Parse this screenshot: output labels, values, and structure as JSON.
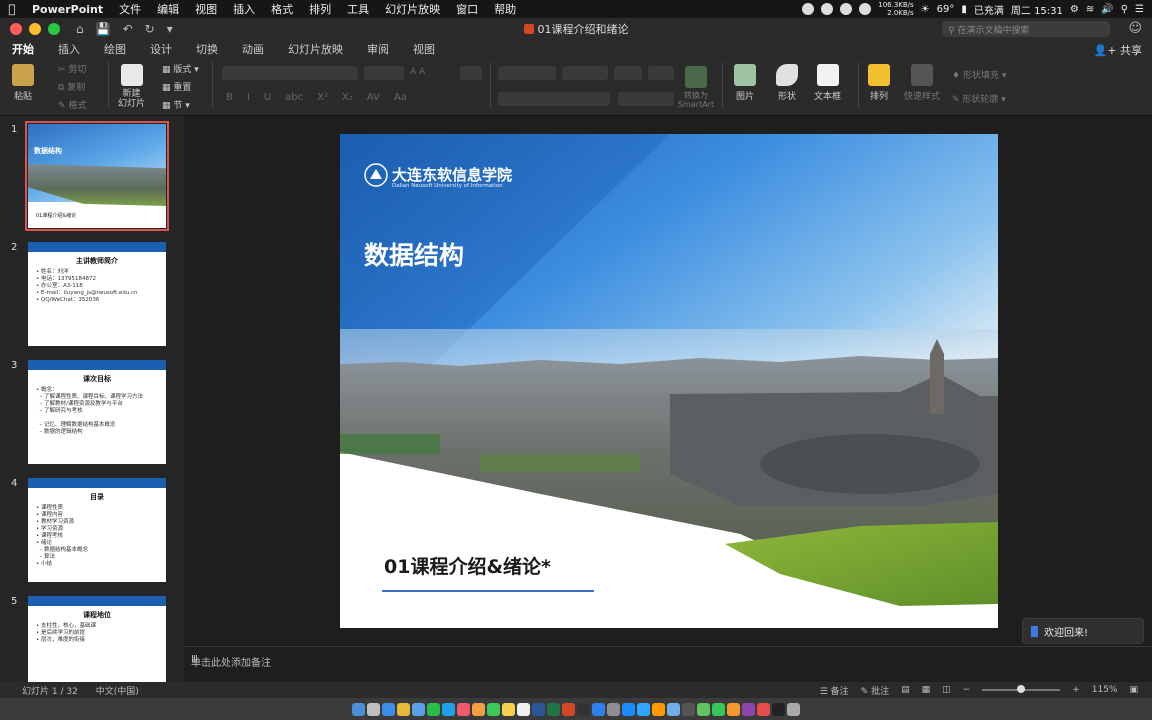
{
  "menubar": {
    "app_name": "PowerPoint",
    "menus": [
      "文件",
      "编辑",
      "视图",
      "插入",
      "格式",
      "排列",
      "工具",
      "幻灯片放映",
      "窗口",
      "帮助"
    ],
    "net_up": "106.3KB/s",
    "net_down": "2.0KB/s",
    "temperature": "69°",
    "battery": "已充满",
    "clock": "周二 15:31"
  },
  "window": {
    "title": "01课程介绍和绪论",
    "search_placeholder": "在演示文稿中搜索"
  },
  "ribbon_tabs": [
    "开始",
    "插入",
    "绘图",
    "设计",
    "切换",
    "动画",
    "幻灯片放映",
    "审阅",
    "视图"
  ],
  "active_tab": "开始",
  "share_label": "共享",
  "ribbon": {
    "paste": "粘贴",
    "cut": "剪切",
    "copy": "复制",
    "format": "格式",
    "new_slide": "新建\n幻灯片",
    "layout": "版式",
    "reset": "重置",
    "section": "节",
    "convert_smartart": "转换为\nSmartArt",
    "picture": "图片",
    "shape": "形状",
    "textbox": "文本框",
    "arrange": "排列",
    "quick_styles": "快速样式",
    "shape_fill": "形状填充",
    "shape_outline": "形状轮廓",
    "font_buttons": [
      "B",
      "I",
      "U",
      "abc",
      "X²",
      "X₂",
      "AV",
      "Aa"
    ],
    "grow_font": "A A"
  },
  "thumbnails": [
    {
      "number": "1",
      "title": "数据结构",
      "subtitle": "01课程介绍&绪论"
    },
    {
      "number": "2",
      "title": "主讲教师简介",
      "lines": "• 姓名：刘洋\n• 电话：13795184872\n• 办公室：A3-118\n• E-mail：liuyang_js@neusoft.edu.cn\n• QQ/WeChat：352036"
    },
    {
      "number": "3",
      "title": "课次目标",
      "lines": "• 概念：\n  – 了解课程性质、课程目标、课程学习方法\n  – 了解教材/课程资源及教学与平台\n  – 了解研究与考核\n\n  – 记忆、理解数据结构基本概念\n  – 数据的逻辑结构"
    },
    {
      "number": "4",
      "title": "目录",
      "lines": "• 课程性质\n• 课程内容\n• 教材学习资源\n• 学习资源\n• 课程考核\n• 绪论\n  – 数据结构基本概念\n  – 算法\n• 小结"
    },
    {
      "number": "5",
      "title": "课程地位",
      "lines": "• 支柱性，核心，基础课\n• 是后续学习的前提\n• 层次，难度的衔接"
    }
  ],
  "slide": {
    "university_cn": "大连东软信息学院",
    "university_en": "Dalian Neusoft University of Information",
    "title": "数据结构",
    "subtitle": "01课程介绍&绪论*"
  },
  "notes_placeholder": "单击此处添加备注",
  "toast": "欢迎回来!",
  "statusbar": {
    "slide_count": "幻灯片 1 / 32",
    "language": "中文(中国)",
    "notes": "备注",
    "comments": "批注",
    "zoom": "115%",
    "zoom_level": 0.5
  },
  "colors": {
    "accent": "#1c5fb2",
    "selection": "#d9534f",
    "traffic_red": "#fe5f57",
    "traffic_yellow": "#febc2e",
    "traffic_green": "#28c840"
  },
  "dock_icons": [
    "finder",
    "launchpad",
    "safari",
    "chrome",
    "mail",
    "wechat",
    "qq",
    "music",
    "photos",
    "messages",
    "notes",
    "calendar",
    "word",
    "excel",
    "powerpoint",
    "terminal",
    "vscode",
    "settings",
    "appstore",
    "photoshop",
    "illustrator",
    "preview",
    "calculator",
    "maps",
    "facetime",
    "books",
    "podcasts",
    "news",
    "stocks",
    "trash"
  ]
}
